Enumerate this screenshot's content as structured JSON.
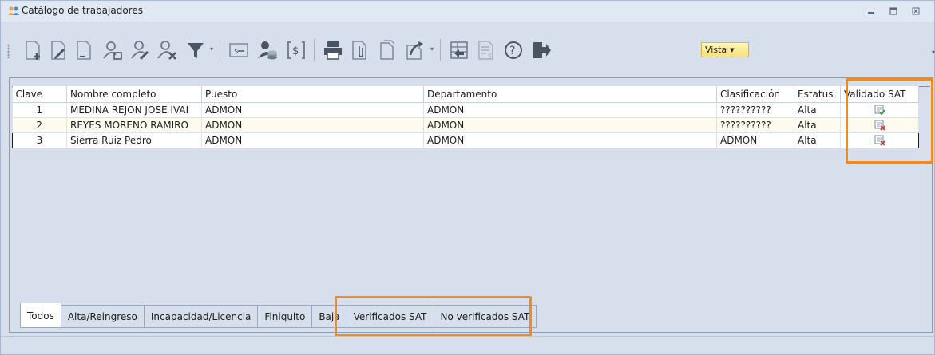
{
  "window": {
    "title": "Catálogo de trabajadores",
    "controls": [
      "minimize",
      "maximize",
      "close"
    ]
  },
  "toolbar": {
    "vista_label": "Vista"
  },
  "table": {
    "columns": [
      "Clave",
      "Nombre completo",
      "Puesto",
      "Departamento",
      "Clasificación",
      "Estatus",
      "Validado SAT"
    ],
    "rows": [
      {
        "clave": "1",
        "nombre": "MEDINA REJON JOSE IVAI",
        "puesto": "ADMON",
        "departamento": "ADMON",
        "clasificacion": "??????????",
        "estatus": "Alta",
        "validado": "verified"
      },
      {
        "clave": "2",
        "nombre": "REYES MORENO RAMIRO",
        "puesto": "ADMON",
        "departamento": "ADMON",
        "clasificacion": "??????????",
        "estatus": "Alta",
        "validado": "not-verified"
      },
      {
        "clave": "3",
        "nombre": "Sierra Ruiz Pedro",
        "puesto": "ADMON",
        "departamento": "ADMON",
        "clasificacion": "ADMON",
        "estatus": "Alta",
        "validado": "not-verified"
      }
    ]
  },
  "tabs": [
    "Todos",
    "Alta/Reingreso",
    "Incapacidad/Licencia",
    "Finiquito",
    "Baja",
    "Verificados SAT",
    "No verificados SAT"
  ],
  "active_tab": "Todos",
  "colors": {
    "highlight": "#f28a1f",
    "frame": "#d6dfeb"
  }
}
